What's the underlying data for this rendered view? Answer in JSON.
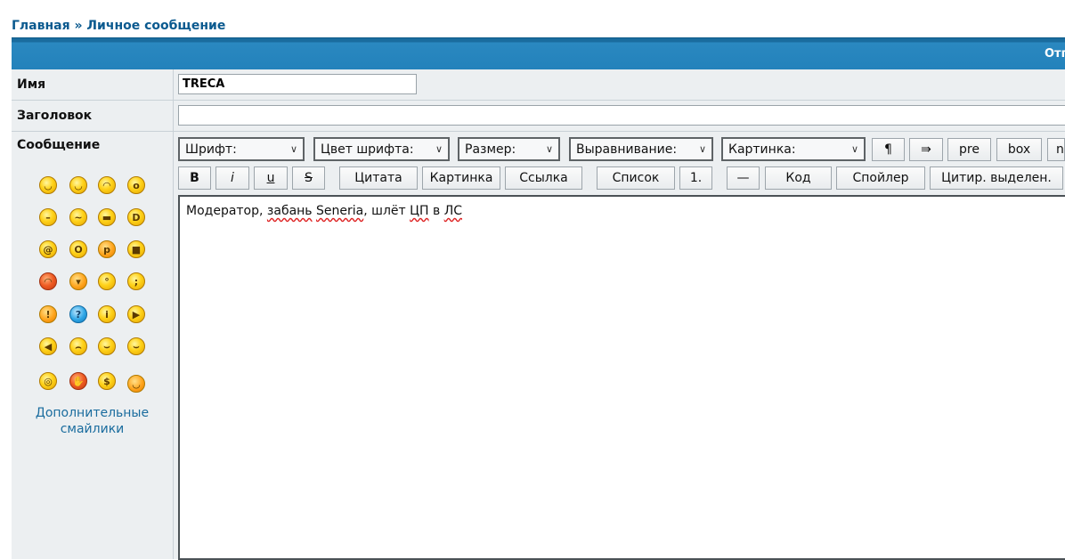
{
  "breadcrumb": {
    "home": "Главная",
    "separator": "»",
    "current": "Личное сообщение"
  },
  "header": {
    "title": "Отпр"
  },
  "form": {
    "name_label": "Имя",
    "name_value": "TRECA",
    "subject_label": "Заголовок",
    "subject_value": "",
    "message_label": "Сообщение",
    "message_text_parts": [
      "Модератор, ",
      "забань",
      " ",
      "Seneria",
      ", шлёт ",
      "ЦП",
      " в ",
      "ЛС"
    ]
  },
  "toolbar": {
    "selects": {
      "font": "Шрифт:",
      "font_color": "Цвет шрифта:",
      "size": "Размер:",
      "align": "Выравнивание:",
      "image": "Картинка:"
    },
    "row1_buttons": {
      "pilcrow": "¶",
      "arrow": "⇛",
      "pre": "pre",
      "box": "box",
      "cut": "n"
    },
    "row2_buttons": {
      "bold": "B",
      "italic": "i",
      "underline": "u",
      "strike": "S",
      "quote": "Цитата",
      "image": "Картинка",
      "link": "Ссылка",
      "list": "Список",
      "list_item": "1.",
      "hr": "—",
      "code": "Код",
      "spoiler": "Спойлер",
      "quote_selection": "Цитир. выделен."
    }
  },
  "smileys": {
    "more_label_line1": "Дополнительные",
    "more_label_line2": "смайлики",
    "icons": [
      "grin-icon",
      "smile-icon",
      "sad-icon",
      "shocked-icon",
      "neutral-icon",
      "confused-icon",
      "cool-icon",
      "laugh-icon",
      "dizzy-icon",
      "eek-icon",
      "tongue-icon",
      "mad-icon",
      "angry-icon",
      "evil-icon",
      "rolleyes-icon",
      "wink-icon",
      "exclamation-icon",
      "question-icon",
      "idea-icon",
      "arrow-right-icon",
      "arrow-left-icon",
      "frown-icon",
      "razz-icon",
      "lol-icon",
      "crazy-icon",
      "facepalm-icon",
      "money-icon",
      "blush-icon"
    ]
  }
}
